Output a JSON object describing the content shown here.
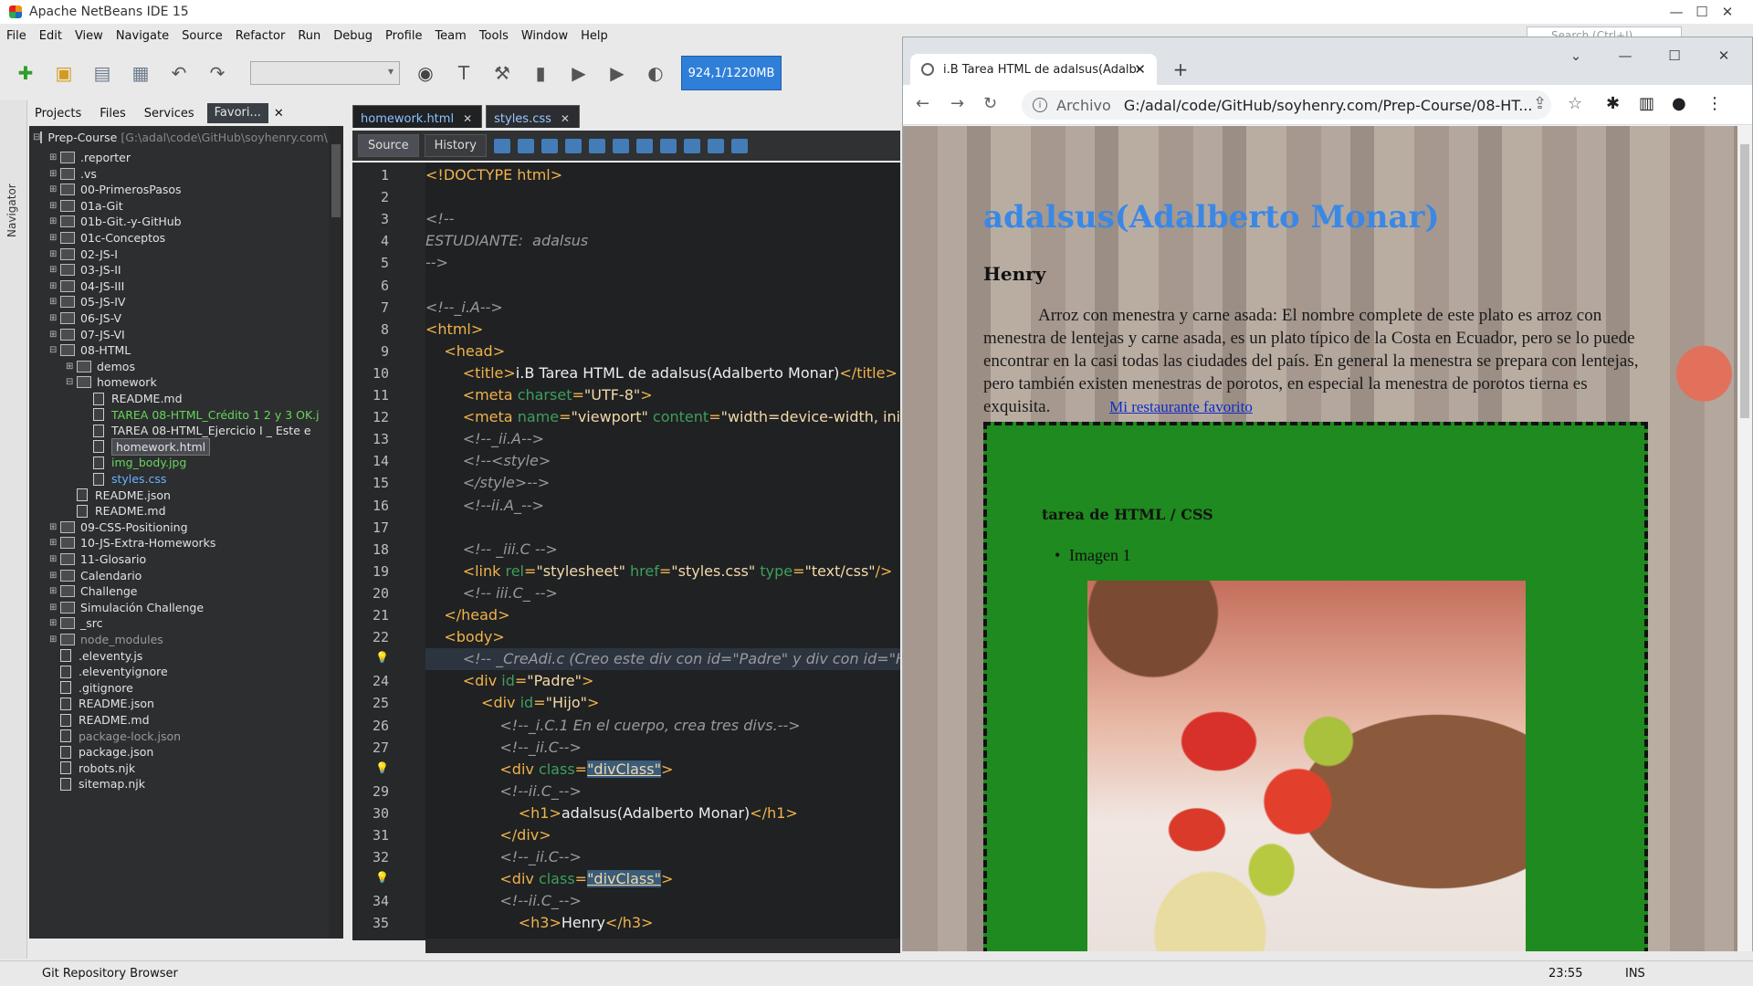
{
  "window": {
    "title": "Apache NetBeans IDE 15",
    "controls": [
      "—",
      "☐",
      "✕"
    ]
  },
  "menu": [
    "File",
    "Edit",
    "View",
    "Navigate",
    "Source",
    "Refactor",
    "Run",
    "Debug",
    "Profile",
    "Team",
    "Tools",
    "Window",
    "Help"
  ],
  "search_placeholder": "Search (Ctrl+I)",
  "toolbar": {
    "memory": "924,1/1220MB"
  },
  "projects_panel": {
    "tabs": [
      "Projects",
      "Files",
      "Services",
      "Favori..."
    ],
    "navigator_label": "Navigator",
    "root": "Prep-Course",
    "root_path": "[G:\\adal\\code\\GitHub\\soyhenry.com\\P",
    "items": [
      {
        "label": ".reporter",
        "depth": 1,
        "kind": "folder",
        "state": "normal"
      },
      {
        "label": ".vs",
        "depth": 1,
        "kind": "folder",
        "state": "normal"
      },
      {
        "label": "00-PrimerosPasos",
        "depth": 1,
        "kind": "folder",
        "state": "normal"
      },
      {
        "label": "01a-Git",
        "depth": 1,
        "kind": "folder",
        "state": "normal"
      },
      {
        "label": "01b-Git.-y-GitHub",
        "depth": 1,
        "kind": "folder",
        "state": "normal"
      },
      {
        "label": "01c-Conceptos",
        "depth": 1,
        "kind": "folder",
        "state": "normal"
      },
      {
        "label": "02-JS-I",
        "depth": 1,
        "kind": "folder",
        "state": "normal"
      },
      {
        "label": "03-JS-II",
        "depth": 1,
        "kind": "folder",
        "state": "normal"
      },
      {
        "label": "04-JS-III",
        "depth": 1,
        "kind": "folder",
        "state": "normal"
      },
      {
        "label": "05-JS-IV",
        "depth": 1,
        "kind": "folder",
        "state": "normal"
      },
      {
        "label": "06-JS-V",
        "depth": 1,
        "kind": "folder",
        "state": "normal"
      },
      {
        "label": "07-JS-VI",
        "depth": 1,
        "kind": "folder",
        "state": "normal"
      },
      {
        "label": "08-HTML",
        "depth": 1,
        "kind": "folder-open",
        "state": "normal"
      },
      {
        "label": "demos",
        "depth": 2,
        "kind": "folder",
        "state": "normal"
      },
      {
        "label": "homework",
        "depth": 2,
        "kind": "folder-open",
        "state": "normal"
      },
      {
        "label": "README.md",
        "depth": 3,
        "kind": "file",
        "state": "normal"
      },
      {
        "label": "TAREA 08-HTML_Crédito 1 2 y 3 OK.j",
        "depth": 3,
        "kind": "file",
        "state": "green"
      },
      {
        "label": "TAREA 08-HTML_Ejercicio I _ Este e",
        "depth": 3,
        "kind": "file",
        "state": "normal"
      },
      {
        "label": "homework.html",
        "depth": 3,
        "kind": "file",
        "state": "selected"
      },
      {
        "label": "img_body.jpg",
        "depth": 3,
        "kind": "file",
        "state": "green"
      },
      {
        "label": "styles.css",
        "depth": 3,
        "kind": "file",
        "state": "blue"
      },
      {
        "label": "README.json",
        "depth": 2,
        "kind": "file",
        "state": "normal"
      },
      {
        "label": "README.md",
        "depth": 2,
        "kind": "file",
        "state": "normal"
      },
      {
        "label": "09-CSS-Positioning",
        "depth": 1,
        "kind": "folder",
        "state": "normal"
      },
      {
        "label": "10-JS-Extra-Homeworks",
        "depth": 1,
        "kind": "folder",
        "state": "normal"
      },
      {
        "label": "11-Glosario",
        "depth": 1,
        "kind": "folder",
        "state": "normal"
      },
      {
        "label": "Calendario",
        "depth": 1,
        "kind": "folder",
        "state": "normal"
      },
      {
        "label": "Challenge",
        "depth": 1,
        "kind": "folder",
        "state": "normal"
      },
      {
        "label": "Simulación Challenge",
        "depth": 1,
        "kind": "folder",
        "state": "normal"
      },
      {
        "label": "_src",
        "depth": 1,
        "kind": "folder",
        "state": "normal"
      },
      {
        "label": "node_modules",
        "depth": 1,
        "kind": "folder",
        "state": "gray"
      },
      {
        "label": ".eleventy.js",
        "depth": 1,
        "kind": "file",
        "state": "normal"
      },
      {
        "label": ".eleventyignore",
        "depth": 1,
        "kind": "file",
        "state": "normal"
      },
      {
        "label": ".gitignore",
        "depth": 1,
        "kind": "file",
        "state": "normal"
      },
      {
        "label": "README.json",
        "depth": 1,
        "kind": "file",
        "state": "normal"
      },
      {
        "label": "README.md",
        "depth": 1,
        "kind": "file",
        "state": "normal"
      },
      {
        "label": "package-lock.json",
        "depth": 1,
        "kind": "file",
        "state": "gray"
      },
      {
        "label": "package.json",
        "depth": 1,
        "kind": "file",
        "state": "normal"
      },
      {
        "label": "robots.njk",
        "depth": 1,
        "kind": "file",
        "state": "normal"
      },
      {
        "label": "sitemap.njk",
        "depth": 1,
        "kind": "file",
        "state": "normal"
      }
    ]
  },
  "editor": {
    "tabs": [
      {
        "label": "homework.html",
        "active": true
      },
      {
        "label": "styles.css",
        "active": false
      }
    ],
    "source_label": "Source",
    "history_label": "History",
    "lines": [
      {
        "n": "1",
        "parts": [
          [
            "t",
            "<!DOCTYPE html>"
          ]
        ]
      },
      {
        "n": "2",
        "parts": []
      },
      {
        "n": "3",
        "parts": [
          [
            "c",
            "<!--"
          ]
        ]
      },
      {
        "n": "4",
        "parts": [
          [
            "c",
            "ESTUDIANTE:  adalsus"
          ]
        ]
      },
      {
        "n": "5",
        "parts": [
          [
            "c",
            "-->"
          ]
        ]
      },
      {
        "n": "6",
        "parts": []
      },
      {
        "n": "7",
        "parts": [
          [
            "c",
            "<!--_i.A-->"
          ]
        ]
      },
      {
        "n": "8",
        "parts": [
          [
            "t",
            "<html>"
          ]
        ]
      },
      {
        "n": "9",
        "parts": [
          [
            "t",
            "    <head>"
          ]
        ]
      },
      {
        "n": "10",
        "parts": [
          [
            "t",
            "        <title>"
          ],
          [
            "x",
            "i.B Tarea HTML de adalsus(Adalberto Monar)"
          ],
          [
            "t",
            "</title>"
          ]
        ]
      },
      {
        "n": "11",
        "parts": [
          [
            "t",
            "        <meta "
          ],
          [
            "a",
            "charset"
          ],
          [
            "t",
            "="
          ],
          [
            "v",
            "\"UTF-8\""
          ],
          [
            "t",
            ">"
          ]
        ]
      },
      {
        "n": "12",
        "parts": [
          [
            "t",
            "        <meta "
          ],
          [
            "a",
            "name"
          ],
          [
            "t",
            "="
          ],
          [
            "v",
            "\"viewport\" "
          ],
          [
            "a",
            "content"
          ],
          [
            "t",
            "="
          ],
          [
            "v",
            "\"width=device-width, init"
          ]
        ]
      },
      {
        "n": "13",
        "parts": [
          [
            "c",
            "        <!--_ii.A-->"
          ]
        ]
      },
      {
        "n": "14",
        "parts": [
          [
            "c",
            "        <!--<style>"
          ]
        ]
      },
      {
        "n": "15",
        "parts": [
          [
            "c",
            "        </style>-->"
          ]
        ]
      },
      {
        "n": "16",
        "parts": [
          [
            "c",
            "        <!--ii.A_-->"
          ]
        ]
      },
      {
        "n": "17",
        "parts": []
      },
      {
        "n": "18",
        "parts": [
          [
            "c",
            "        <!-- _iii.C -->"
          ]
        ]
      },
      {
        "n": "19",
        "parts": [
          [
            "t",
            "        <link "
          ],
          [
            "a",
            "rel"
          ],
          [
            "t",
            "="
          ],
          [
            "v",
            "\"stylesheet\" "
          ],
          [
            "a",
            "href"
          ],
          [
            "t",
            "="
          ],
          [
            "v",
            "\"styles.css\" "
          ],
          [
            "a",
            "type"
          ],
          [
            "t",
            "="
          ],
          [
            "v",
            "\"text/css\""
          ],
          [
            "t",
            "/>"
          ]
        ]
      },
      {
        "n": "20",
        "parts": [
          [
            "c",
            "        <!-- iii.C_ -->"
          ]
        ]
      },
      {
        "n": "21",
        "parts": [
          [
            "t",
            "    </head>"
          ]
        ]
      },
      {
        "n": "22",
        "parts": [
          [
            "t",
            "    <body>"
          ]
        ]
      },
      {
        "n": "",
        "parts": [
          [
            "c",
            "        <!-- _CreAdi.c (Creo este div con id=\"Padre\" y div con id=\"Hijo\""
          ]
        ]
      },
      {
        "n": "24",
        "parts": [
          [
            "t",
            "        <div "
          ],
          [
            "a",
            "id"
          ],
          [
            "t",
            "="
          ],
          [
            "v",
            "\"Padre\""
          ],
          [
            "t",
            ">"
          ]
        ]
      },
      {
        "n": "25",
        "parts": [
          [
            "t",
            "            <div "
          ],
          [
            "a",
            "id"
          ],
          [
            "t",
            "="
          ],
          [
            "v",
            "\"Hijo\""
          ],
          [
            "t",
            ">"
          ]
        ]
      },
      {
        "n": "26",
        "parts": [
          [
            "c",
            "                <!--_i.C.1 En el cuerpo, crea tres divs.-->"
          ]
        ]
      },
      {
        "n": "27",
        "parts": [
          [
            "c",
            "                <!--_ii.C-->"
          ]
        ]
      },
      {
        "n": "",
        "parts": [
          [
            "t",
            "                <div "
          ],
          [
            "a",
            "class"
          ],
          [
            "t",
            "="
          ],
          [
            "h",
            "\"divClass\""
          ],
          [
            "t",
            ">"
          ]
        ]
      },
      {
        "n": "29",
        "parts": [
          [
            "c",
            "                <!--ii.C_-->"
          ]
        ]
      },
      {
        "n": "30",
        "parts": [
          [
            "t",
            "                    <h1>"
          ],
          [
            "x",
            "adalsus(Adalberto Monar)"
          ],
          [
            "t",
            "</h1>"
          ]
        ]
      },
      {
        "n": "31",
        "parts": [
          [
            "t",
            "                </div>"
          ]
        ]
      },
      {
        "n": "32",
        "parts": [
          [
            "c",
            "                <!--_ii.C-->"
          ]
        ]
      },
      {
        "n": "",
        "parts": [
          [
            "t",
            "                <div "
          ],
          [
            "a",
            "class"
          ],
          [
            "t",
            "="
          ],
          [
            "h",
            "\"divClass\""
          ],
          [
            "t",
            ">"
          ]
        ]
      },
      {
        "n": "34",
        "parts": [
          [
            "c",
            "                <!--ii.C_-->"
          ]
        ]
      },
      {
        "n": "35",
        "parts": [
          [
            "t",
            "                    <h3>"
          ],
          [
            "x",
            "Henry"
          ],
          [
            "t",
            "</h3>"
          ]
        ]
      }
    ]
  },
  "status": {
    "git_browser": "Git Repository Browser",
    "time": "23:55",
    "mode": "INS"
  },
  "browser": {
    "tab_title": "i.B Tarea HTML de adalsus(Adalb·",
    "address_prefix": "Archivo",
    "url": "G:/adal/code/GitHub/soyhenry.com/Prep-Course/08-HT...",
    "page": {
      "h1": "adalsus(Adalberto Monar)",
      "h3": "Henry",
      "paragraph": "Arroz con menestra y carne asada: El nombre complete de este plato es arroz con menestra de lentejas y carne asada, es un plato típico de la Costa en Ecuador, pero se lo puede encontrar en la casi todas las ciudades del país. En general la menestra se prepara con lentejas, pero también existen menestras de porotos, en especial la menestra de porotos tierna es exquisita.",
      "link": "Mi restaurante favorito",
      "box_title": "tarea de HTML / CSS",
      "list_item": "Imagen 1"
    }
  }
}
